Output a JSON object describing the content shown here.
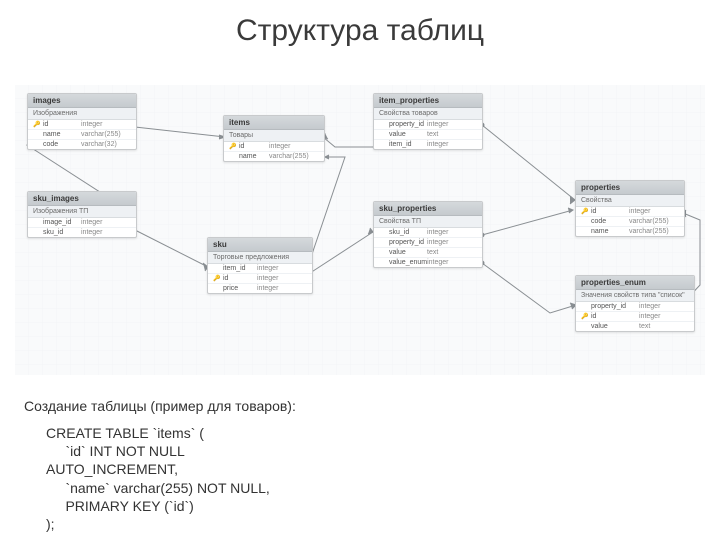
{
  "title": "Структура таблиц",
  "caption": "Создание таблицы (пример для товаров):",
  "sql": "CREATE TABLE `items` (\n     `id` INT NOT NULL \nAUTO_INCREMENT,\n     `name` varchar(255) NOT NULL,\n     PRIMARY KEY (`id`)\n);",
  "tables": {
    "images": {
      "name": "images",
      "label": "Изображения",
      "cols": [
        {
          "pk": true,
          "name": "id",
          "type": "integer"
        },
        {
          "pk": false,
          "name": "name",
          "type": "varchar(255)"
        },
        {
          "pk": false,
          "name": "code",
          "type": "varchar(32)"
        }
      ]
    },
    "sku_images": {
      "name": "sku_images",
      "label": "Изображения ТП",
      "cols": [
        {
          "pk": false,
          "name": "image_id",
          "type": "integer"
        },
        {
          "pk": false,
          "name": "sku_id",
          "type": "integer"
        }
      ]
    },
    "items": {
      "name": "items",
      "label": "Товары",
      "cols": [
        {
          "pk": true,
          "name": "id",
          "type": "integer"
        },
        {
          "pk": false,
          "name": "name",
          "type": "varchar(255)"
        }
      ]
    },
    "sku": {
      "name": "sku",
      "label": "Торговые предложения",
      "cols": [
        {
          "pk": false,
          "name": "item_id",
          "type": "integer"
        },
        {
          "pk": true,
          "name": "id",
          "type": "integer"
        },
        {
          "pk": false,
          "name": "price",
          "type": "integer"
        }
      ]
    },
    "item_properties": {
      "name": "item_properties",
      "label": "Свойства товаров",
      "cols": [
        {
          "pk": false,
          "name": "property_id",
          "type": "integer"
        },
        {
          "pk": false,
          "name": "value",
          "type": "text"
        },
        {
          "pk": false,
          "name": "item_id",
          "type": "integer"
        }
      ]
    },
    "sku_properties": {
      "name": "sku_properties",
      "label": "Свойства ТП",
      "cols": [
        {
          "pk": false,
          "name": "sku_id",
          "type": "integer"
        },
        {
          "pk": false,
          "name": "property_id",
          "type": "integer"
        },
        {
          "pk": false,
          "name": "value",
          "type": "text"
        },
        {
          "pk": false,
          "name": "value_enum",
          "type": "integer"
        }
      ]
    },
    "properties": {
      "name": "properties",
      "label": "Свойства",
      "cols": [
        {
          "pk": true,
          "name": "id",
          "type": "integer"
        },
        {
          "pk": false,
          "name": "code",
          "type": "varchar(255)"
        },
        {
          "pk": false,
          "name": "name",
          "type": "varchar(255)"
        }
      ]
    },
    "properties_enum": {
      "name": "properties_enum",
      "label": "Значения свойств типа \"список\"",
      "cols": [
        {
          "pk": false,
          "name": "property_id",
          "type": "integer"
        },
        {
          "pk": true,
          "name": "id",
          "type": "integer"
        },
        {
          "pk": false,
          "name": "value",
          "type": "text"
        }
      ]
    }
  }
}
